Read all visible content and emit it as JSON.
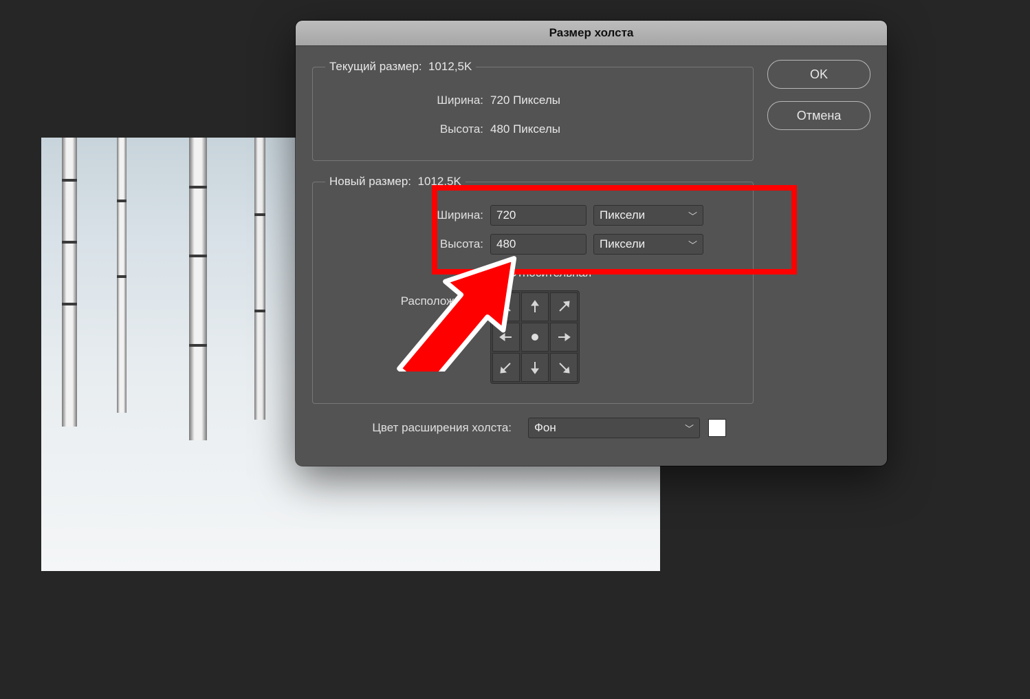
{
  "dialog": {
    "title": "Размер холста",
    "ok_label": "OK",
    "cancel_label": "Отмена",
    "current": {
      "legend": "Текущий размер:",
      "size_value": "1012,5K",
      "width_label": "Ширина:",
      "width_value": "720 Пикселы",
      "height_label": "Высота:",
      "height_value": "480 Пикселы"
    },
    "new": {
      "legend": "Новый размер:",
      "size_value": "1012,5K",
      "width_label": "Ширина:",
      "width_value": "720",
      "width_unit": "Пиксели",
      "height_label": "Высота:",
      "height_value": "480",
      "height_unit": "Пиксели",
      "relative_label": "Относительная",
      "relative_checked": false,
      "anchor_label": "Расположение:"
    },
    "extension": {
      "label": "Цвет расширения холста:",
      "value": "Фон",
      "swatch_color": "#ffffff"
    }
  },
  "annotation": {
    "highlight_area": "width-height-inputs"
  }
}
